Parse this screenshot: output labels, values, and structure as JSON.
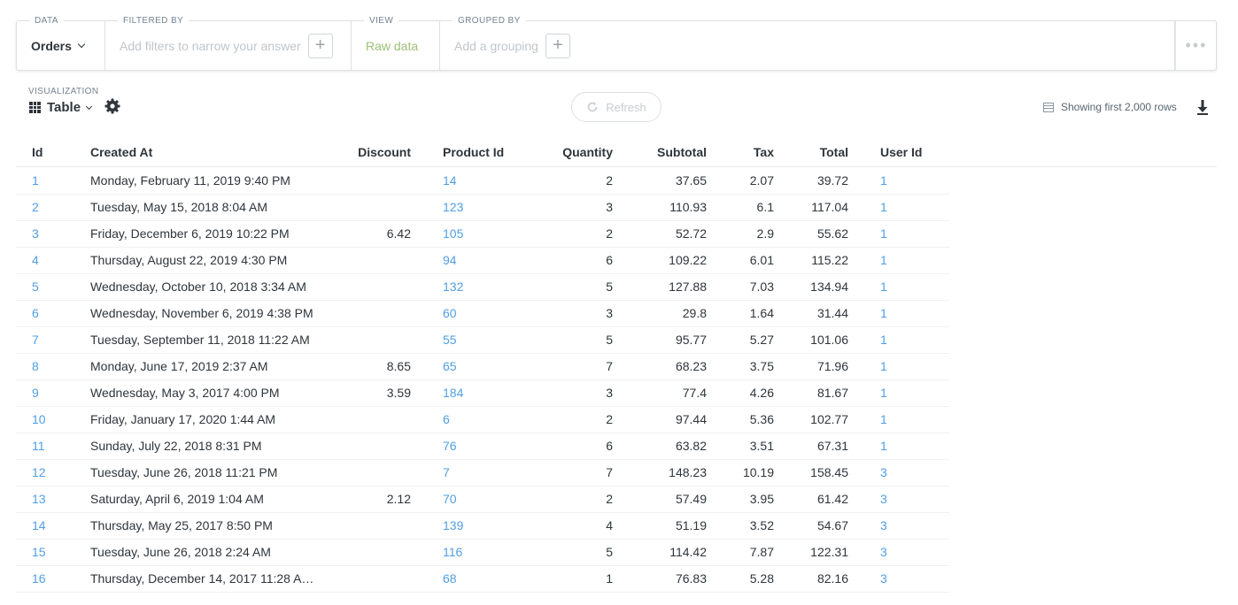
{
  "querybar": {
    "data_label": "DATA",
    "data_source": "Orders",
    "filter_label": "FILTERED BY",
    "filter_placeholder": "Add filters to narrow your answer",
    "view_label": "VIEW",
    "view_value": "Raw data",
    "group_label": "GROUPED BY",
    "group_placeholder": "Add a grouping",
    "add_symbol": "+",
    "more_symbol": "•••"
  },
  "visualization": {
    "label": "VISUALIZATION",
    "type": "Table",
    "refresh_label": "Refresh",
    "rows_info": "Showing first 2,000 rows"
  },
  "table": {
    "columns": [
      "Id",
      "Created At",
      "Discount",
      "Product Id",
      "Quantity",
      "Subtotal",
      "Tax",
      "Total",
      "User Id"
    ],
    "rows": [
      [
        "1",
        "Monday, February 11, 2019 9:40 PM",
        "",
        "14",
        "2",
        "37.65",
        "2.07",
        "39.72",
        "1"
      ],
      [
        "2",
        "Tuesday, May 15, 2018 8:04 AM",
        "",
        "123",
        "3",
        "110.93",
        "6.1",
        "117.04",
        "1"
      ],
      [
        "3",
        "Friday, December 6, 2019 10:22 PM",
        "6.42",
        "105",
        "2",
        "52.72",
        "2.9",
        "55.62",
        "1"
      ],
      [
        "4",
        "Thursday, August 22, 2019 4:30 PM",
        "",
        "94",
        "6",
        "109.22",
        "6.01",
        "115.22",
        "1"
      ],
      [
        "5",
        "Wednesday, October 10, 2018 3:34 AM",
        "",
        "132",
        "5",
        "127.88",
        "7.03",
        "134.94",
        "1"
      ],
      [
        "6",
        "Wednesday, November 6, 2019 4:38 PM",
        "",
        "60",
        "3",
        "29.8",
        "1.64",
        "31.44",
        "1"
      ],
      [
        "7",
        "Tuesday, September 11, 2018 11:22 AM",
        "",
        "55",
        "5",
        "95.77",
        "5.27",
        "101.06",
        "1"
      ],
      [
        "8",
        "Monday, June 17, 2019 2:37 AM",
        "8.65",
        "65",
        "7",
        "68.23",
        "3.75",
        "71.96",
        "1"
      ],
      [
        "9",
        "Wednesday, May 3, 2017 4:00 PM",
        "3.59",
        "184",
        "3",
        "77.4",
        "4.26",
        "81.67",
        "1"
      ],
      [
        "10",
        "Friday, January 17, 2020 1:44 AM",
        "",
        "6",
        "2",
        "97.44",
        "5.36",
        "102.77",
        "1"
      ],
      [
        "11",
        "Sunday, July 22, 2018 8:31 PM",
        "",
        "76",
        "6",
        "63.82",
        "3.51",
        "67.31",
        "1"
      ],
      [
        "12",
        "Tuesday, June 26, 2018 11:21 PM",
        "",
        "7",
        "7",
        "148.23",
        "10.19",
        "158.45",
        "3"
      ],
      [
        "13",
        "Saturday, April 6, 2019 1:04 AM",
        "2.12",
        "70",
        "2",
        "57.49",
        "3.95",
        "61.42",
        "3"
      ],
      [
        "14",
        "Thursday, May 25, 2017 8:50 PM",
        "",
        "139",
        "4",
        "51.19",
        "3.52",
        "54.67",
        "3"
      ],
      [
        "15",
        "Tuesday, June 26, 2018 2:24 AM",
        "",
        "116",
        "5",
        "114.42",
        "7.87",
        "122.31",
        "3"
      ],
      [
        "16",
        "Thursday, December 14, 2017 11:28 A…",
        "",
        "68",
        "1",
        "76.83",
        "5.28",
        "82.16",
        "3"
      ]
    ]
  },
  "colors": {
    "link": "#509ee3",
    "raw_data": "#9cc177",
    "text": "#2e353b"
  }
}
